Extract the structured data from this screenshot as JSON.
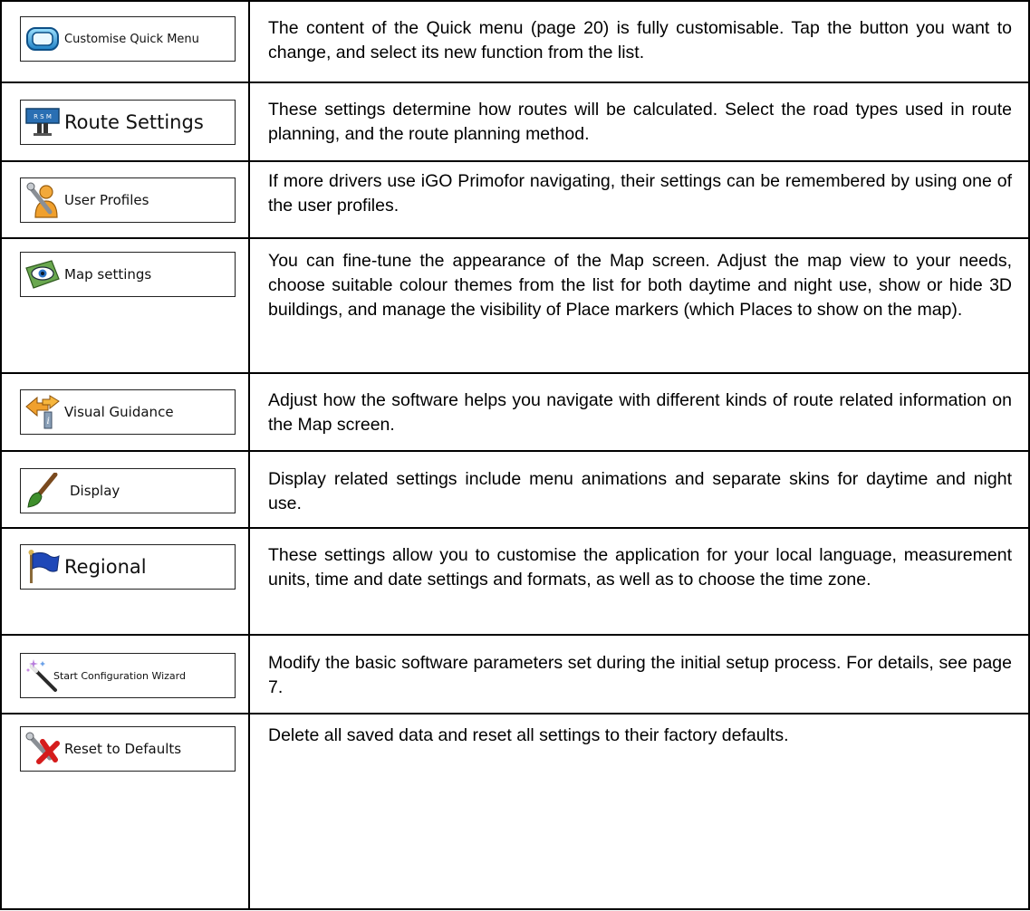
{
  "settings": [
    {
      "icon": "quick-menu-icon",
      "label": "Customise Quick Menu",
      "description": "The content of the Quick menu (page 20) is fully customisable. Tap the button you want to change, and select its new function from the list."
    },
    {
      "icon": "road-sign-icon",
      "label": "Route Settings",
      "description": "These settings determine how routes will be calculated. Select the road types used in route planning, and the route planning method."
    },
    {
      "icon": "user-wrench-icon",
      "label": "User Profiles",
      "description": "If more drivers use iGO Primofor navigating, their settings can be remembered by using one of the user profiles."
    },
    {
      "icon": "eye-map-icon",
      "label": "Map settings",
      "description": "You can fine-tune the appearance of the Map screen. Adjust the map view to your needs, choose suitable colour themes from the list for both daytime and night use, show or hide 3D buildings,  and manage the visibility of Place markers (which Places to show on the map)."
    },
    {
      "icon": "signpost-info-icon",
      "label": "Visual Guidance",
      "description": "Adjust how the software helps you navigate with different kinds of route related information on the Map screen."
    },
    {
      "icon": "paintbrush-icon",
      "label": "Display",
      "description": "Display related settings include menu animations and separate skins for daytime and night use."
    },
    {
      "icon": "flag-icon",
      "label": "Regional",
      "description": "These settings allow you to customise the application for your local language, measurement units, time and date settings and formats, as well as to choose the time zone."
    },
    {
      "icon": "magic-wand-icon",
      "label": "Start Configuration Wizard",
      "description": "Modify the basic software parameters set during the initial setup process. For details, see page 7."
    },
    {
      "icon": "reset-wrench-icon",
      "label": "Reset to Defaults",
      "description": "Delete all saved data and reset all settings to their factory defaults."
    }
  ]
}
